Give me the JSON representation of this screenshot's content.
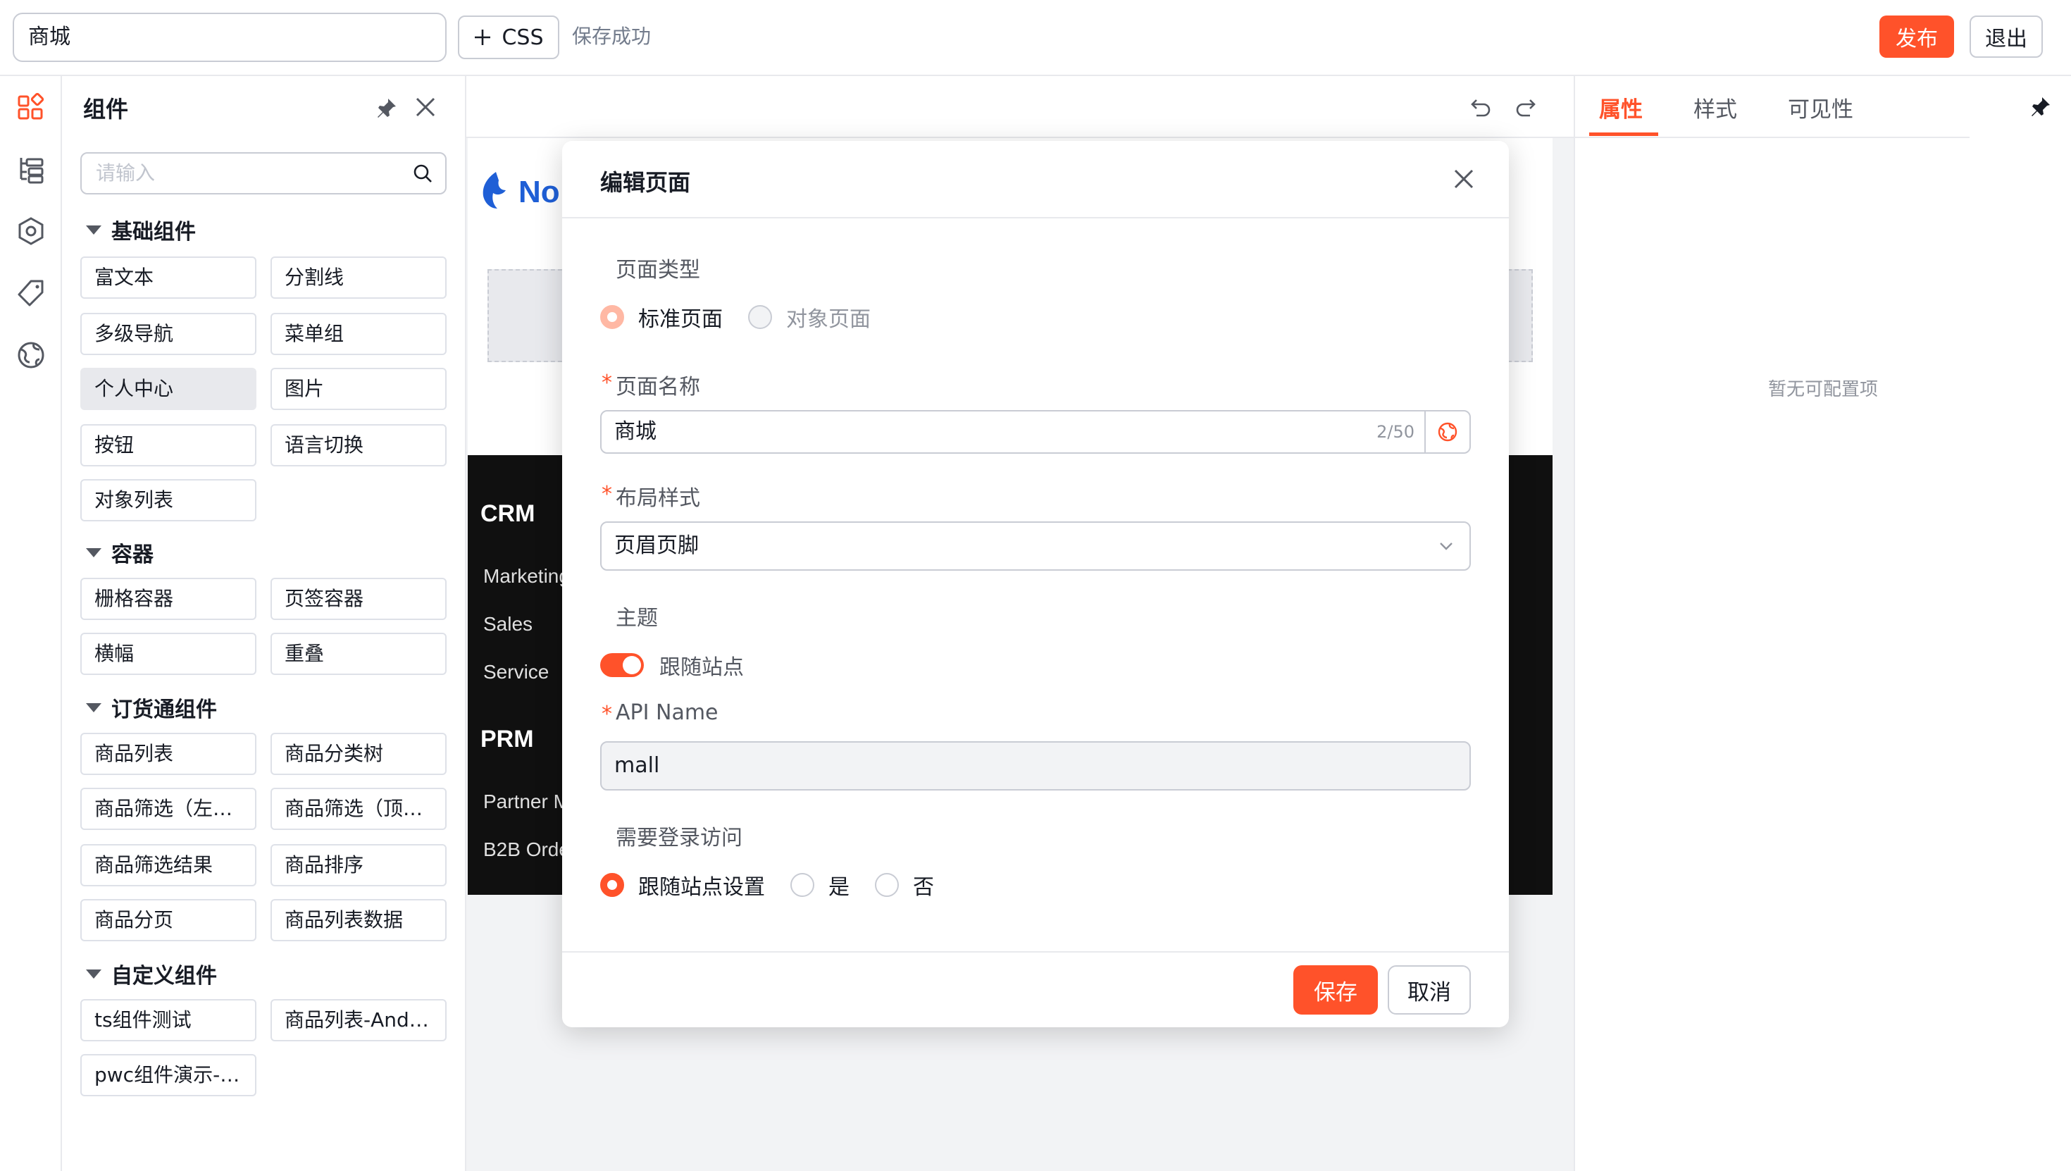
{
  "topbar": {
    "page_name": "商城",
    "css_label": "CSS",
    "save_status": "保存成功",
    "publish_label": "发布",
    "exit_label": "退出"
  },
  "components_panel": {
    "title": "组件",
    "search_placeholder": "请输入",
    "groups": [
      {
        "title": "基础组件",
        "items": [
          "富文本",
          "分割线",
          "多级导航",
          "菜单组",
          "个人中心",
          "图片",
          "按钮",
          "语言切换",
          "对象列表"
        ]
      },
      {
        "title": "容器",
        "items": [
          "栅格容器",
          "页签容器",
          "横幅",
          "重叠"
        ]
      },
      {
        "title": "订货通组件",
        "items": [
          "商品列表",
          "商品分类树",
          "商品筛选（左侧）",
          "商品筛选（顶部）",
          "商品筛选结果",
          "商品排序",
          "商品分页",
          "商品列表数据"
        ]
      },
      {
        "title": "自定义组件",
        "items": [
          "ts组件测试",
          "商品列表-Andy测试",
          "pwc组件演示-abc"
        ]
      }
    ],
    "active_item": "个人中心"
  },
  "canvas": {
    "logo_text": "No",
    "nav": {
      "crm_heading": "CRM",
      "crm_items": [
        "Marketing",
        "Sales",
        "Service"
      ],
      "prm_heading": "PRM",
      "prm_items": [
        "Partner M",
        "B2B Orde"
      ]
    }
  },
  "right_panel": {
    "tabs": [
      "属性",
      "样式",
      "可见性"
    ],
    "active_tab": "属性",
    "empty_text": "暂无可配置项"
  },
  "modal": {
    "title": "编辑页面",
    "page_type_label": "页面类型",
    "page_type_options": [
      "标准页面",
      "对象页面"
    ],
    "page_type_selected": "标准页面",
    "page_name_label": "页面名称",
    "page_name_value": "商城",
    "page_name_counter": "2/50",
    "layout_label": "布局样式",
    "layout_value": "页眉页脚",
    "theme_label": "主题",
    "theme_toggle_label": "跟随站点",
    "theme_toggle_on": true,
    "api_name_label": "API Name",
    "api_name_value": "mall",
    "login_label": "需要登录访问",
    "login_options": [
      "跟随站点设置",
      "是",
      "否"
    ],
    "login_selected": "跟随站点设置",
    "save_label": "保存",
    "cancel_label": "取消"
  },
  "colors": {
    "accent": "#ff522a",
    "border": "#c9ccd4",
    "dark_nav": "#101010"
  }
}
